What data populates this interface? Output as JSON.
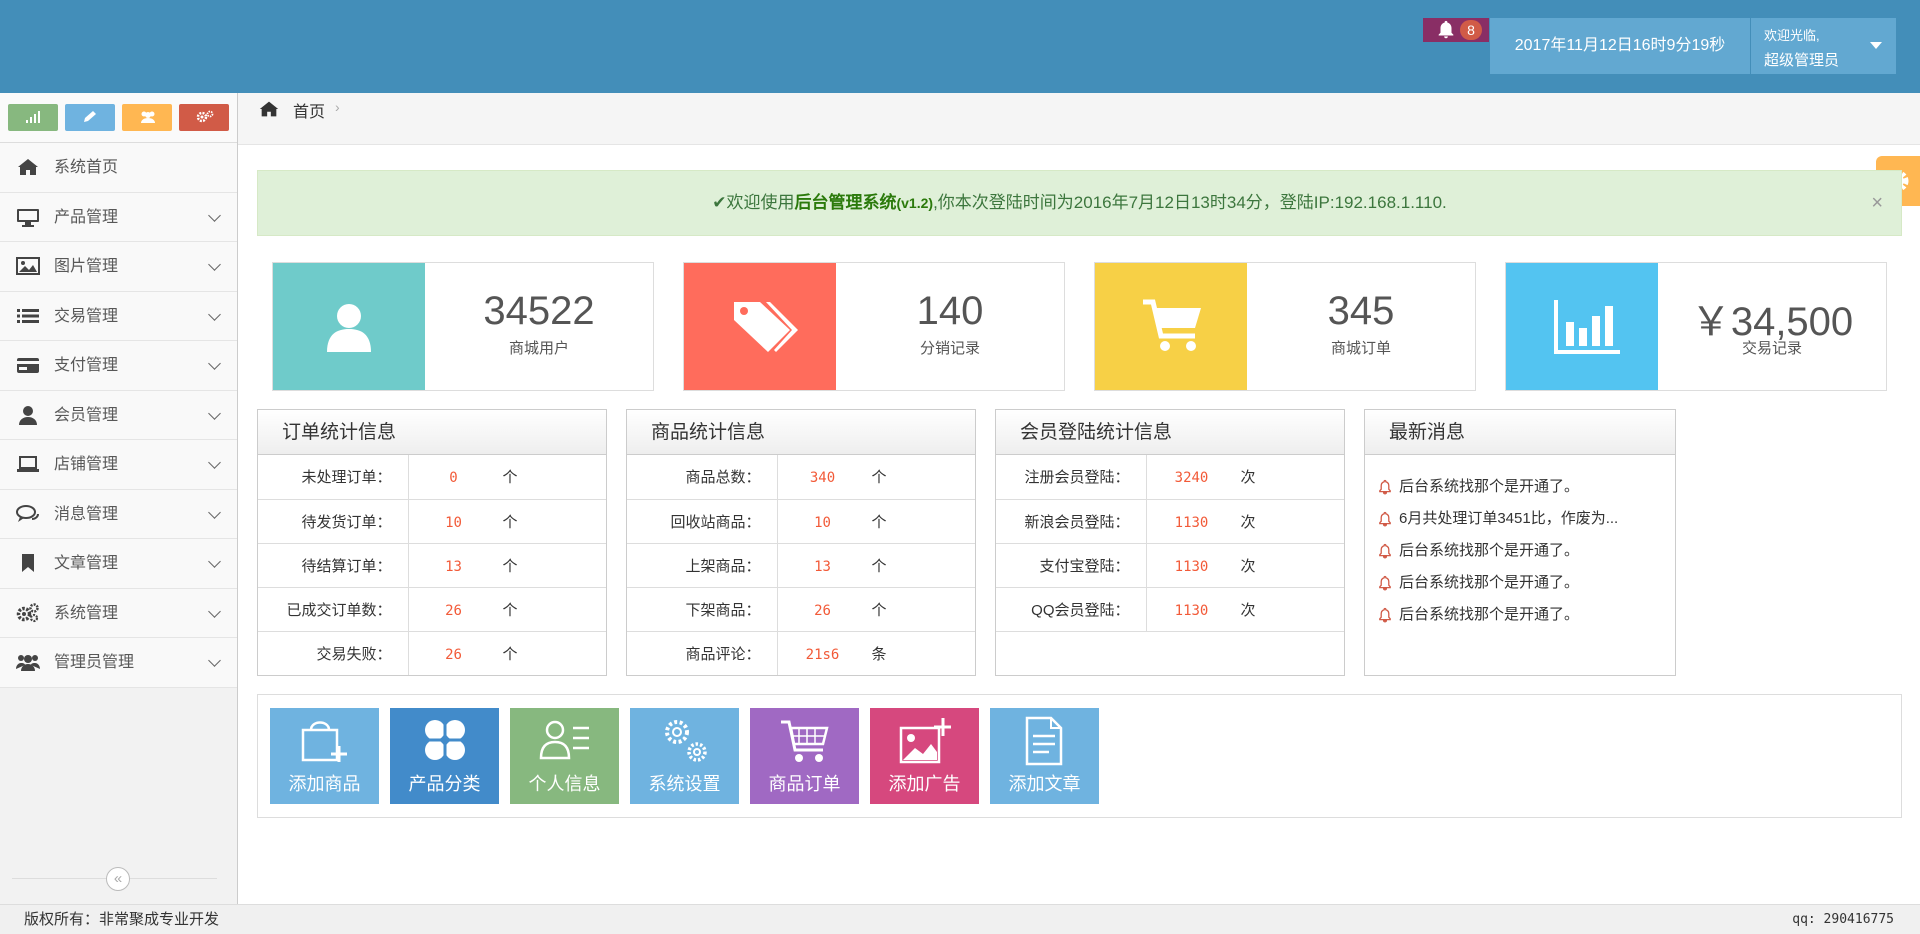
{
  "header": {
    "notification_count": "8",
    "datetime": "2017年11月12日16时9分19秒",
    "welcome": "欢迎光临,",
    "user_name": "超级管理员"
  },
  "sidebar": {
    "shortcuts": [
      {
        "name": "signal-icon",
        "color": "#87b87f"
      },
      {
        "name": "pencil-icon",
        "color": "#6fb3e0"
      },
      {
        "name": "users-icon",
        "color": "#ffb752"
      },
      {
        "name": "cogs-icon",
        "color": "#d15b47"
      }
    ],
    "items": [
      {
        "label": "系统首页",
        "icon": "home-icon",
        "has_submenu": false
      },
      {
        "label": "产品管理",
        "icon": "desktop-icon",
        "has_submenu": true
      },
      {
        "label": "图片管理",
        "icon": "picture-icon",
        "has_submenu": true
      },
      {
        "label": "交易管理",
        "icon": "list-icon",
        "has_submenu": true
      },
      {
        "label": "支付管理",
        "icon": "credit-card-icon",
        "has_submenu": true
      },
      {
        "label": "会员管理",
        "icon": "user-icon",
        "has_submenu": true
      },
      {
        "label": "店铺管理",
        "icon": "laptop-icon",
        "has_submenu": true
      },
      {
        "label": "消息管理",
        "icon": "comments-icon",
        "has_submenu": true
      },
      {
        "label": "文章管理",
        "icon": "bookmark-icon",
        "has_submenu": true
      },
      {
        "label": "系统管理",
        "icon": "cogs-icon",
        "has_submenu": true
      },
      {
        "label": "管理员管理",
        "icon": "group-icon",
        "has_submenu": true
      }
    ],
    "collapse_glyph": "«"
  },
  "breadcrumb": {
    "home": "首页",
    "separator": "›"
  },
  "alert": {
    "prefix": "欢迎使用",
    "system_name": "后台管理系统",
    "version": "(v1.2)",
    "suffix": ",你本次登陆时间为2016年7月12日13时34分，登陆IP:192.168.1.110.",
    "close": "×"
  },
  "stats": [
    {
      "value": "34522",
      "label": "商城用户",
      "color": "#6fcbca",
      "icon": "user-icon"
    },
    {
      "value": "140",
      "label": "分销记录",
      "color": "#ff6c5c",
      "icon": "tags-icon"
    },
    {
      "value": "345",
      "label": "商城订单",
      "color": "#f7d046",
      "icon": "cart-icon"
    },
    {
      "value": "￥34,500",
      "label": "交易记录",
      "color": "#53c4f1",
      "icon": "bar-chart-icon"
    }
  ],
  "panels": {
    "orders": {
      "title": "订单统计信息",
      "rows": [
        {
          "label": "未处理订单：",
          "value": "0",
          "unit": "个"
        },
        {
          "label": "待发货订单：",
          "value": "10",
          "unit": "个"
        },
        {
          "label": "待结算订单：",
          "value": "13",
          "unit": "个"
        },
        {
          "label": "已成交订单数：",
          "value": "26",
          "unit": "个"
        },
        {
          "label": "交易失败：",
          "value": "26",
          "unit": "个"
        }
      ]
    },
    "products": {
      "title": "商品统计信息",
      "rows": [
        {
          "label": "商品总数：",
          "value": "340",
          "unit": "个"
        },
        {
          "label": "回收站商品：",
          "value": "10",
          "unit": "个"
        },
        {
          "label": "上架商品：",
          "value": "13",
          "unit": "个"
        },
        {
          "label": "下架商品：",
          "value": "26",
          "unit": "个"
        },
        {
          "label": "商品评论：",
          "value": "21s6",
          "unit": "条"
        }
      ]
    },
    "logins": {
      "title": "会员登陆统计信息",
      "rows": [
        {
          "label": "注册会员登陆：",
          "value": "3240",
          "unit": "次"
        },
        {
          "label": "新浪会员登陆：",
          "value": "1130",
          "unit": "次"
        },
        {
          "label": "支付宝登陆：",
          "value": "1130",
          "unit": "次"
        },
        {
          "label": "QQ会员登陆：",
          "value": "1130",
          "unit": "次"
        }
      ]
    },
    "news": {
      "title": "最新消息",
      "items": [
        "后台系统找那个是开通了。",
        "6月共处理订单3451比，作废为...",
        "后台系统找那个是开通了。",
        "后台系统找那个是开通了。",
        "后台系统找那个是开通了。"
      ]
    }
  },
  "quick_actions": [
    {
      "label": "添加商品",
      "color": "#6fb3e0",
      "icon": "add-goods-icon"
    },
    {
      "label": "产品分类",
      "color": "#428bca",
      "icon": "category-icon"
    },
    {
      "label": "个人信息",
      "color": "#87b87f",
      "icon": "profile-icon"
    },
    {
      "label": "系统设置",
      "color": "#6fb3e0",
      "icon": "settings-icon"
    },
    {
      "label": "商品订单",
      "color": "#a069c3",
      "icon": "order-cart-icon"
    },
    {
      "label": "添加广告",
      "color": "#d6487e",
      "icon": "add-image-icon"
    },
    {
      "label": "添加文章",
      "color": "#6fb3e0",
      "icon": "add-article-icon"
    }
  ],
  "footer": {
    "copyright": "版权所有：非常聚成专业开发",
    "qq": "qq: 290416775"
  }
}
